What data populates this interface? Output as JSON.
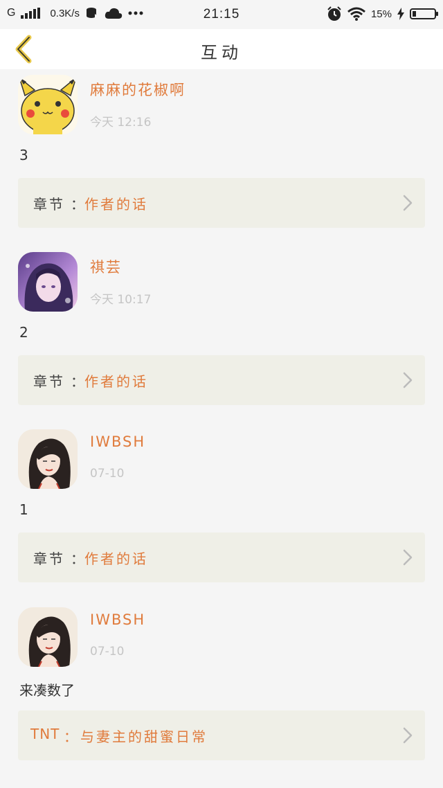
{
  "status_bar": {
    "carrier": "G",
    "net_speed": "0.3K/s",
    "time": "21:15",
    "battery_percent": "15%",
    "icons": [
      "signal-icon",
      "data-sync-icon",
      "cloud-icon",
      "more-dots-icon",
      "alarm-icon",
      "wifi-icon",
      "charging-icon",
      "battery-icon"
    ]
  },
  "nav": {
    "title": "互动",
    "back_icon": "chevron-left-icon",
    "accent": "#e8c84a"
  },
  "colors": {
    "username": "#e07b3c",
    "time": "#c5c5c5",
    "chapter_bg": "#efefe7"
  },
  "posts": [
    {
      "username": "麻麻的花椒啊",
      "time": "今天 12:16",
      "content": "3",
      "chapter_label": "章节",
      "chapter_sep": "：",
      "chapter_value": "作者的话",
      "avatar": "pikachu-avatar"
    },
    {
      "username": "祺芸",
      "time": "今天 10:17",
      "content": "2",
      "chapter_label": "章节",
      "chapter_sep": "：",
      "chapter_value": "作者的话",
      "avatar": "anime-girl-avatar"
    },
    {
      "username": "IWBSH",
      "time": "07-10",
      "content": "1",
      "chapter_label": "章节",
      "chapter_sep": "：",
      "chapter_value": "作者的话",
      "avatar": "sketch-girl-avatar"
    },
    {
      "username": "IWBSH",
      "time": "07-10",
      "content": "来凑数了",
      "chapter_label": "TNT",
      "chapter_sep": "：",
      "chapter_value": "与妻主的甜蜜日常",
      "avatar": "sketch-girl-avatar"
    }
  ]
}
